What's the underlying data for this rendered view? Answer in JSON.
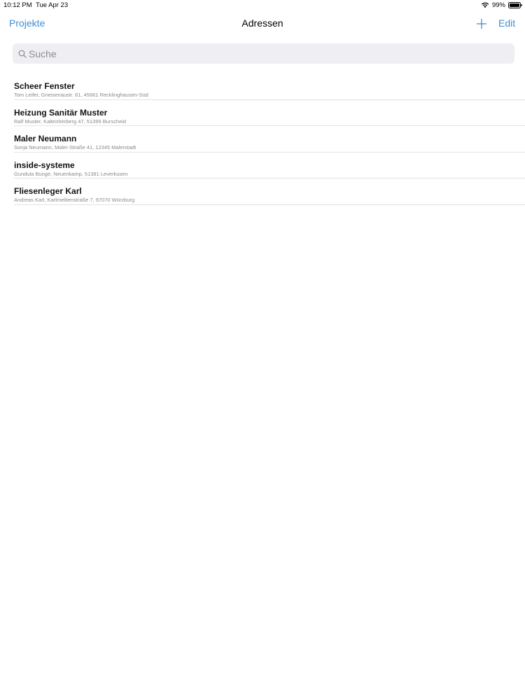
{
  "status_bar": {
    "time": "10:12 PM",
    "date": "Tue Apr 23",
    "battery_percent": "99%",
    "icons": [
      "wifi-icon",
      "battery-icon"
    ]
  },
  "nav": {
    "back_label": "Projekte",
    "title": "Adressen",
    "add_icon": "plus-icon",
    "edit_label": "Edit",
    "accent_color": "#3b8fd6"
  },
  "search": {
    "placeholder": "Suche",
    "value": "",
    "icon": "search-icon"
  },
  "addresses": [
    {
      "name": "Scheer Fenster",
      "detail": "Tom Leifer, Gneisenaustr. 61, 45661  Recklinghausen-Süd"
    },
    {
      "name": "Heizung Sanitär Muster",
      "detail": "Ralf Muster, Kaltenherberg 47, 51399 Burscheid"
    },
    {
      "name": "Maler Neumann",
      "detail": "Sonja Neumann, Maler-Straße 41, 12345 Malerstadt"
    },
    {
      "name": "inside-systeme",
      "detail": "Gundula Bunge, Neuenkamp, 51381 Leverkusen"
    },
    {
      "name": "Fliesenleger Karl",
      "detail": "Andreas Karl, Karlmelitenstraße 7, 97070 Würzburg"
    }
  ]
}
